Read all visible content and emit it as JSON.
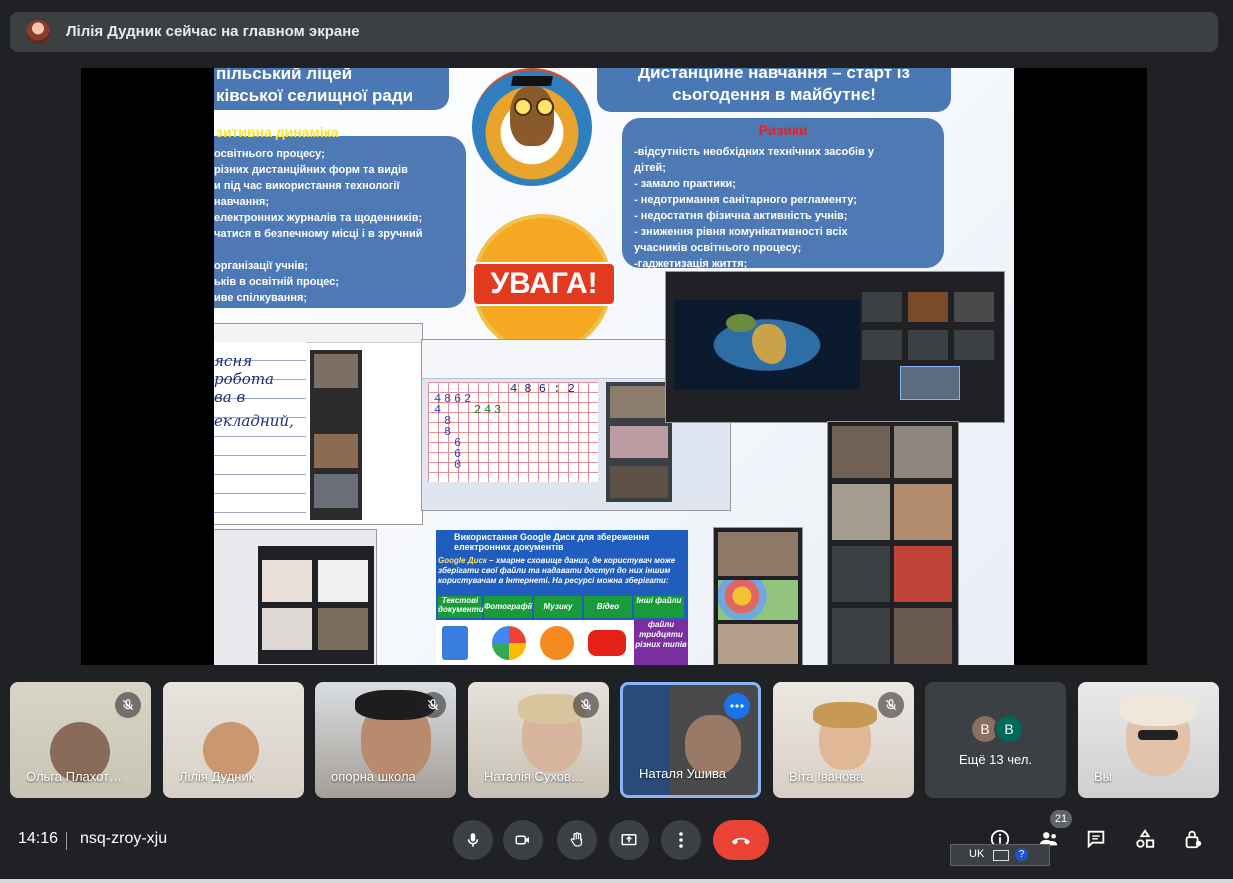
{
  "presenter_banner": {
    "text": "Лілія Дудник сейчас на главном экране"
  },
  "slide": {
    "title_left_line1": "пільський ліцей",
    "title_left_line2": "ківської селищної ради",
    "title_right_line1": "Дистанційне навчання – старт із",
    "title_right_line2": "сьогодення в майбутнє!",
    "positive_heading": "зитивна динаміка",
    "positive_items": [
      "освітнього процесу;",
      "різних дистанційних форм та видів",
      "и під час використання технології",
      "навчання;",
      "електронних журналів та щоденників;",
      "чатися в безпечному місці і в зручний",
      "",
      "організації учнів;",
      "ьків в освітній процес;",
      "иве спілкування;"
    ],
    "risks_heading": "Ризики",
    "risks_items": [
      "-відсутність необхідних технічних засобів у",
      "дітей;",
      "- замало практики;",
      "- недотримання санітарного регламенту;",
      "- недостатня фізична активність учнів;",
      "- зниження рівня комунікативності всіх",
      "учасників освітнього процесу;",
      "-гаджетизація життя;"
    ],
    "attention_label": "УВАГА!",
    "notebook_lines": [
      "ясня",
      "робота",
      "ва в",
      "екладний,"
    ],
    "math_top": "4 8 6 : 2",
    "math_digits": [
      "4",
      "8",
      "6",
      "2",
      "4",
      "2",
      "4",
      "3",
      "8",
      "8",
      "6",
      "6",
      "0"
    ],
    "google_drive": {
      "title": "Використання Google Диск для збереження електронних документів",
      "description_bold": "Google Диск",
      "description": " – хмарне сховище даних, де користувач може зберігати свої файли та надавати доступ до них іншим користувачам в Інтернеті. На ресурсі можна зберігати:",
      "categories": [
        "Текстові документи",
        "Фотографії",
        "Музику",
        "Відео",
        "Інші файли"
      ],
      "extra_label": "файли тридцяти різних типів"
    }
  },
  "participants": [
    {
      "name": "Ольга Плахот…",
      "muted": true
    },
    {
      "name": "Лілія Дудник",
      "muted": false
    },
    {
      "name": "опорна школа",
      "muted": true
    },
    {
      "name": "Наталія Сухов…",
      "muted": true
    },
    {
      "name": "Наталя Ушива",
      "muted": false,
      "active": true
    },
    {
      "name": "Віта Іванова",
      "muted": true
    },
    {
      "name": "Ещё 13 чел.",
      "avatars": [
        "В",
        "В"
      ]
    },
    {
      "name": "Вы",
      "muted": false
    }
  ],
  "bottom": {
    "time": "14:16",
    "meeting_code": "nsq-zroy-xju",
    "people_count": "21",
    "keyboard_lang": "UK"
  },
  "colors": {
    "end_call": "#ea4335",
    "active_border": "#8ab4f8",
    "slide_box": "#4a78b4",
    "risk_heading": "#e0202a",
    "positive_heading": "#f5e63a"
  }
}
